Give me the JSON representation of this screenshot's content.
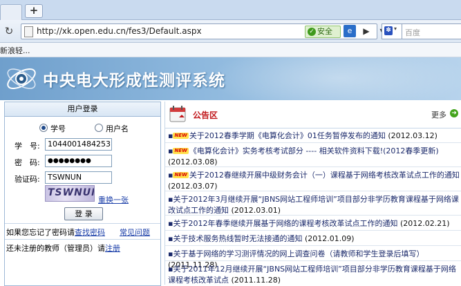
{
  "browser": {
    "url": "http://xk.open.edu.cn/fes3/Default.aspx",
    "secure_label": "安全",
    "search_placeholder": "百度",
    "favorites": [
      "新浪轻..."
    ]
  },
  "site": {
    "title": "中央电大形成性测评系统"
  },
  "login": {
    "header": "用户登录",
    "radio_options": [
      "学号",
      "用户名"
    ],
    "selected_radio": "学号",
    "student_id_label": "学　号:",
    "student_id_value": "1044001484253",
    "password_label": "密　码:",
    "password_value": "●●●●●●●●",
    "captcha_label": "验证码:",
    "captcha_value": "TSWNUN",
    "captcha_image_text": "TSWNUN",
    "refresh_link": "重换一张",
    "login_button": "登 录",
    "forgot_text": "如果您忘记了密码请",
    "forgot_link": "查找密码",
    "faq_link": "常见问题",
    "register_text": "还未注册的教师（管理员）请",
    "register_link": "注册"
  },
  "notice": {
    "title": "公告区",
    "more_label": "更多",
    "new_badge": "NEW",
    "items": [
      {
        "new": true,
        "text": "关于2012春季学期《电算化会计》01任务暂停发布的通知",
        "date": "(2012.03.12)"
      },
      {
        "new": true,
        "text": "《电算化会计》实务考核考试部分 ---- 相关软件资料下载!(2012春季更新)",
        "date": "(2012.03.08)"
      },
      {
        "new": true,
        "text": "关于2012春继续开展中级财务会计（一）课程基于网络考核改革试点工作的通知",
        "date": "(2012.03.07)"
      },
      {
        "new": false,
        "text": "关于2012年3月继续开展“JBNS网站工程师培训”项目部分非学历教育课程基于网络课改试点工作的通知",
        "date": "(2012.03.01)"
      },
      {
        "new": false,
        "text": "关于2012年春季继续开展基于网络的课程考核改革试点工作的通知",
        "date": "(2012.02.21)"
      },
      {
        "new": false,
        "text": "关于技术服务热线暂时无法接通的通知",
        "date": "(2012.01.09)"
      },
      {
        "new": false,
        "text": "关于基于网络的学习测评情况的网上调查问卷（请教师和学生登录后填写）",
        "date": "(2011.11.28)"
      },
      {
        "new": false,
        "text": "关于2011年12月继续开展“JBNS网站工程师培训”项目部分非学历教育课程基于网络课程考核改革试点",
        "date": "(2011.11.28)"
      }
    ]
  }
}
